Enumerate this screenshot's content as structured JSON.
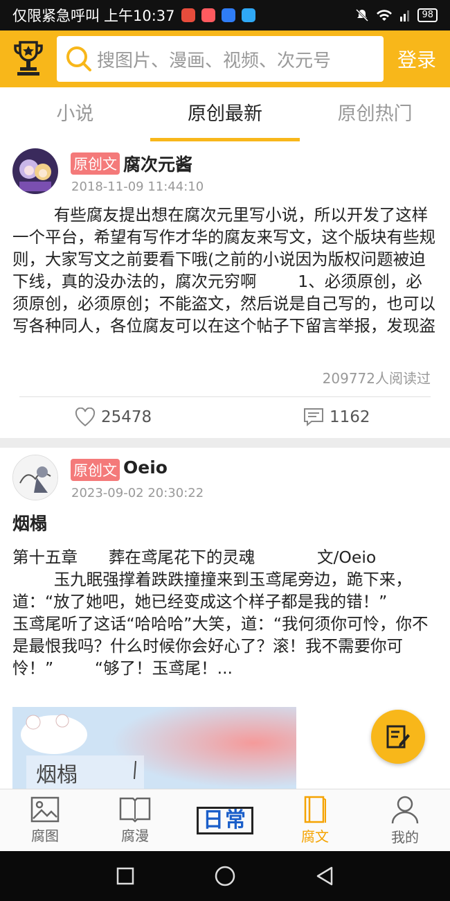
{
  "status": {
    "carrier": "仅限紧急呼叫",
    "time": "上午10:37",
    "battery": "98",
    "app_colors": [
      "#e74c3c",
      "#e74c3c",
      "#2f7df6",
      "#2f9df6"
    ]
  },
  "header": {
    "search_placeholder": "搜图片、漫画、视频、次元号",
    "login_label": "登录",
    "accent": "#f8b71a"
  },
  "tabs": [
    {
      "label": "小说"
    },
    {
      "label": "原创最新"
    },
    {
      "label": "原创热门"
    }
  ],
  "posts": [
    {
      "badge": "原创文",
      "author": "腐次元酱",
      "time": "2018-11-09 11:44:10",
      "body": "        有些腐友提出想在腐次元里写小说，所以开发了这样一个平台，希望有写作才华的腐友来写文，这个版块有些规则，大家写文之前要看下哦(之前的小说因为版权问题被迫下线，真的没办法的，腐次元穷啊        1、必须原创，必须原创，必须原创；不能盗文，然后说是自己写的，也可以写各种同人，各位腐友可以在这个帖子下留言举报，发现盗",
      "reads": "209772人阅读过",
      "likes": "25478",
      "comments": "1162"
    },
    {
      "badge": "原创文",
      "author": "Oeio",
      "time": "2023-09-02 20:30:22",
      "title": "烟榻",
      "body": "第十五章      葬在鸢尾花下的灵魂            文/Oeio\n        玉九眠强撑着跌跌撞撞来到玉鸢尾旁边，跪下来，道：“放了她吧，她已经变成这个样子都是我的错！”        玉鸢尾听了这话“哈哈哈”大笑，道：“我何须你可怜，你不是最恨我吗？什么时候你会好心了？滚！我不需要你可怜！”        “够了！玉鸢尾！...",
      "thumb_text": "烟榻"
    }
  ],
  "bottom_nav": [
    {
      "label": "腐图",
      "icon": "image-icon"
    },
    {
      "label": "腐漫",
      "icon": "book-open-icon"
    },
    {
      "label": "日常",
      "icon": "daily-logo"
    },
    {
      "label": "腐文",
      "icon": "novel-icon"
    },
    {
      "label": "我的",
      "icon": "user-icon"
    }
  ]
}
